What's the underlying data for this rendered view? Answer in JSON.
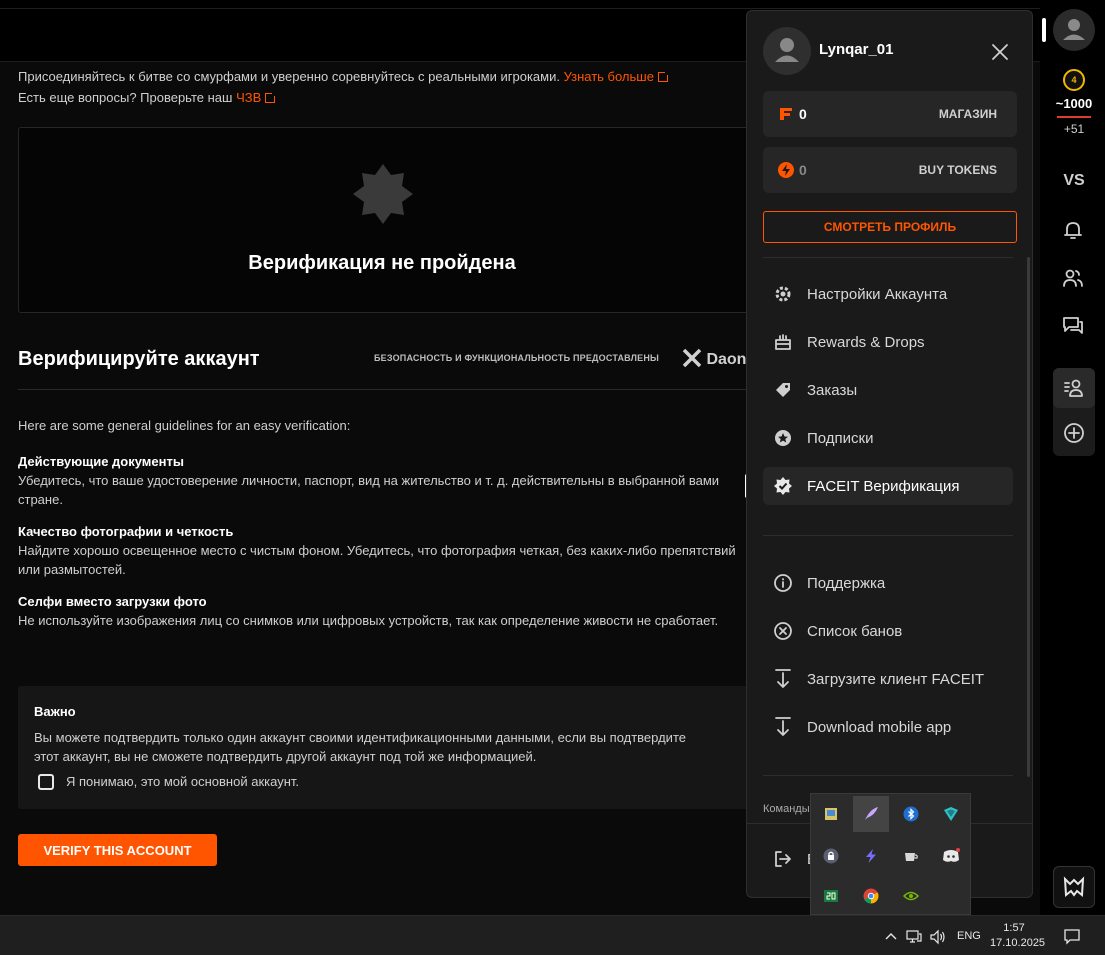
{
  "intro": {
    "line1_text": "Присоединяйтесь к битве со смурфами и уверенно соревнуйтесь с реальными игроками.",
    "line1_link": "Узнать больше",
    "line2_text": "Есть еще вопросы? Проверьте наш",
    "line2_link": "ЧЗВ"
  },
  "verify_card": {
    "title": "Верификация не пройдена"
  },
  "section": {
    "title": "Верифицируйте аккаунт",
    "powered_by": "БЕЗОПАСНОСТЬ И ФУНКЦИОНАЛЬНОСТЬ ПРЕДОСТАВЛЕНЫ",
    "provider": "Daon"
  },
  "guidelines": {
    "lead": "Here are some general guidelines for an easy verification:",
    "items": [
      {
        "title": "Действующие документы",
        "text": "Убедитесь, что ваше удостоверение личности, паспорт, вид на жительство и т. д. действительны в выбранной вами стране."
      },
      {
        "title": "Качество фотографии и четкость",
        "text": "Найдите хорошо освещенное место с чистым фоном. Убедитесь, что фотография четкая, без каких-либо препятствий или размытостей."
      },
      {
        "title": "Селфи вместо загрузки фото",
        "text": "Не используйте изображения лиц со снимков или цифровых устройств, так как определение живости не сработает."
      }
    ]
  },
  "important": {
    "title": "Важно",
    "text": "Вы можете подтвердить только один аккаунт своими идентификационными данными, если вы подтвердите этот аккаунт, вы не сможете подтвердить другой аккаунт под той же информацией.",
    "checkbox_label": "Я понимаю, это мой основной аккаунт.",
    "checked": false
  },
  "verify_button": "VERIFY THIS ACCOUNT",
  "panel": {
    "username": "Lynqar_01",
    "points_value": "0",
    "points_action": "МАГАЗИН",
    "tokens_value": "0",
    "tokens_action": "BUY TOKENS",
    "profile_button": "СМОТРЕТЬ ПРОФИЛЬ",
    "menu": [
      {
        "label": "Настройки Аккаунта",
        "icon": "gear-icon"
      },
      {
        "label": "Rewards & Drops",
        "icon": "gift-icon"
      },
      {
        "label": "Заказы",
        "icon": "tag-icon"
      },
      {
        "label": "Подписки",
        "icon": "star-badge-icon"
      },
      {
        "label": "FACEIT Верификация",
        "icon": "verified-badge-icon",
        "active": true
      }
    ],
    "support_menu": [
      {
        "label": "Поддержка",
        "icon": "info-icon"
      },
      {
        "label": "Список банов",
        "icon": "ban-icon"
      },
      {
        "label": "Загрузите клиент FACEIT",
        "icon": "download-icon"
      },
      {
        "label": "Download mobile app",
        "icon": "download-icon"
      }
    ],
    "teams_label": "Команды",
    "logout_label": "В"
  },
  "rail": {
    "level": "4",
    "elo": "~1000",
    "elo_delta": "+51",
    "vs_label": "VS"
  },
  "taskbar": {
    "language": "ENG",
    "time": "1:57",
    "date": "17.10.2025"
  },
  "colors": {
    "accent": "#ff5500",
    "level": "#f2b500"
  }
}
